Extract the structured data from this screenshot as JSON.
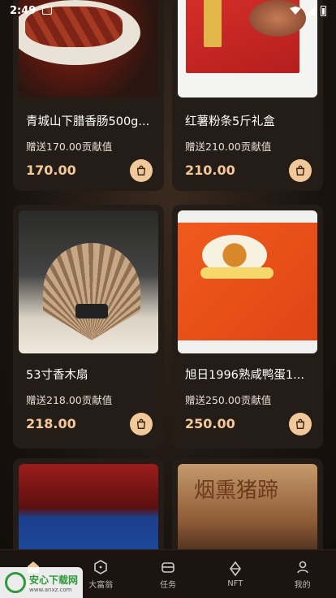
{
  "status_bar": {
    "time": "2:49"
  },
  "products": [
    {
      "title": "青城山下腊香肠500g...",
      "reward": "赠送170.00贡献值",
      "price": "170.00",
      "image": "sausage"
    },
    {
      "title": "红薯粉条5斤礼盒",
      "reward": "赠送210.00贡献值",
      "price": "210.00",
      "image": "noodle"
    },
    {
      "title": "53寸香木扇",
      "reward": "赠送218.00贡献值",
      "price": "218.00",
      "image": "fan"
    },
    {
      "title": "旭日1996熟咸鸭蛋1...",
      "reward": "赠送250.00贡献值",
      "price": "250.00",
      "image": "egg"
    },
    {
      "title": "",
      "reward": "",
      "price": "",
      "image": "red-box"
    },
    {
      "title": "",
      "reward": "",
      "price": "",
      "image": "hoof",
      "brand": "烟熏猪蹄"
    }
  ],
  "tabbar": {
    "items": [
      {
        "label": "首页",
        "icon": "home-icon"
      },
      {
        "label": "大富翁",
        "icon": "dice-icon"
      },
      {
        "label": "任务",
        "icon": "task-icon"
      },
      {
        "label": "NFT",
        "icon": "nft-icon"
      },
      {
        "label": "我的",
        "icon": "profile-icon"
      }
    ]
  },
  "watermark": {
    "main": "安心下载网",
    "sub": "www.anxz.com"
  },
  "colors": {
    "price": "#f3c99a",
    "cart_button": "#f1c899",
    "card_bg": "#241c17"
  }
}
